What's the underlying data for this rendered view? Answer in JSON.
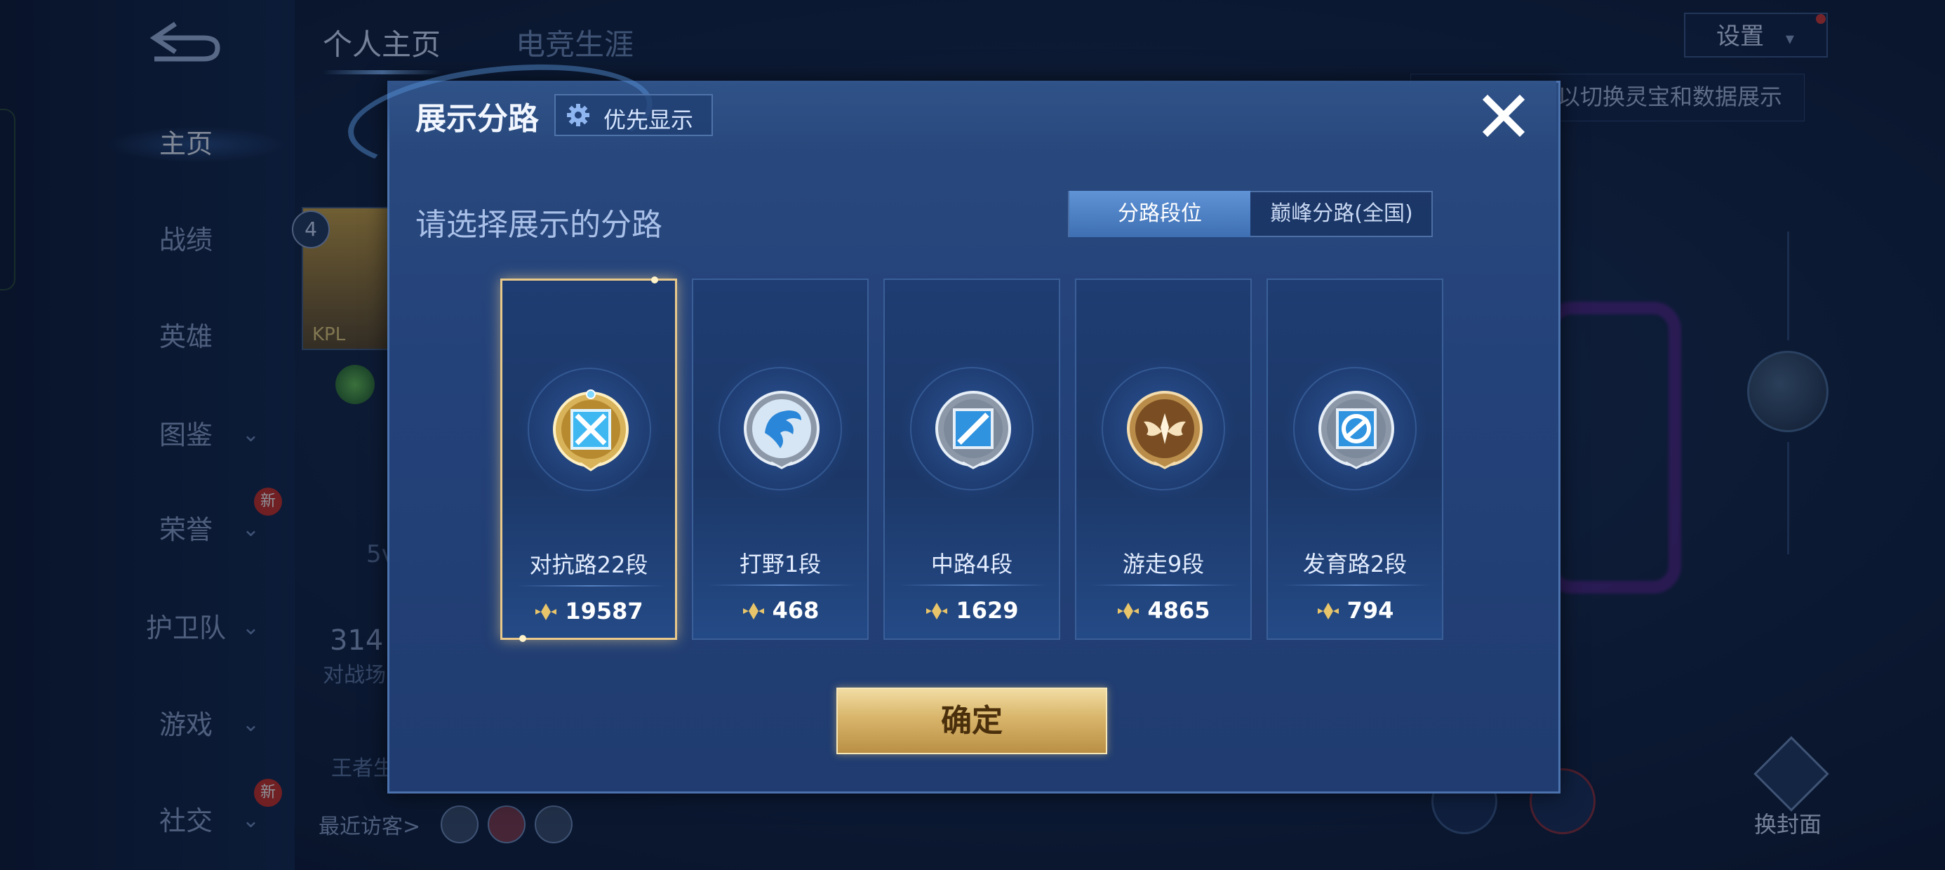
{
  "background": {
    "sidebar": {
      "items": [
        {
          "label": "主页",
          "active": true
        },
        {
          "label": "战绩"
        },
        {
          "label": "英雄"
        },
        {
          "label": "图鉴",
          "has_chevron": true
        },
        {
          "label": "荣誉",
          "has_chevron": true,
          "badge": "新"
        },
        {
          "label": "护卫队",
          "has_chevron": true
        },
        {
          "label": "游戏",
          "has_chevron": true
        },
        {
          "label": "社交",
          "has_chevron": true,
          "badge": "新"
        }
      ]
    },
    "top_tabs": [
      {
        "label": "个人主页",
        "active": true
      },
      {
        "label": "电竞生涯",
        "active": false
      }
    ],
    "settings_label": "设置",
    "tooltip_text": "以切换灵宝和数据展示",
    "profile_level_badge": "4",
    "profile_name_fragment": "KPL",
    "bg_text_1": "5v",
    "bg_text_2": "314",
    "bg_text_3": "对战场",
    "bg_text_4": "王者生",
    "visitors_label": "最近访客>",
    "swap_cover_label": "换封面"
  },
  "dialog": {
    "title": "展示分路",
    "priority_button": "优先显示",
    "subtitle": "请选择展示的分路",
    "segment_options": [
      "分路段位",
      "巅峰分路(全国)"
    ],
    "segment_selected": "分路段位",
    "lanes": [
      {
        "label": "对抗路22段",
        "score": "19587",
        "medal": "gold-sword",
        "selected": true
      },
      {
        "label": "打野1段",
        "score": "468",
        "medal": "silver-dragon",
        "selected": false
      },
      {
        "label": "中路4段",
        "score": "1629",
        "medal": "silver-staff",
        "selected": false
      },
      {
        "label": "游走9段",
        "score": "4865",
        "medal": "bronze-wings",
        "selected": false
      },
      {
        "label": "发育路2段",
        "score": "794",
        "medal": "silver-arrow",
        "selected": false
      }
    ],
    "confirm_label": "确定"
  },
  "colors": {
    "accent_gold": "#e9c98a",
    "panel_blue": "#24427a",
    "segment_active": "#4f82c6"
  }
}
